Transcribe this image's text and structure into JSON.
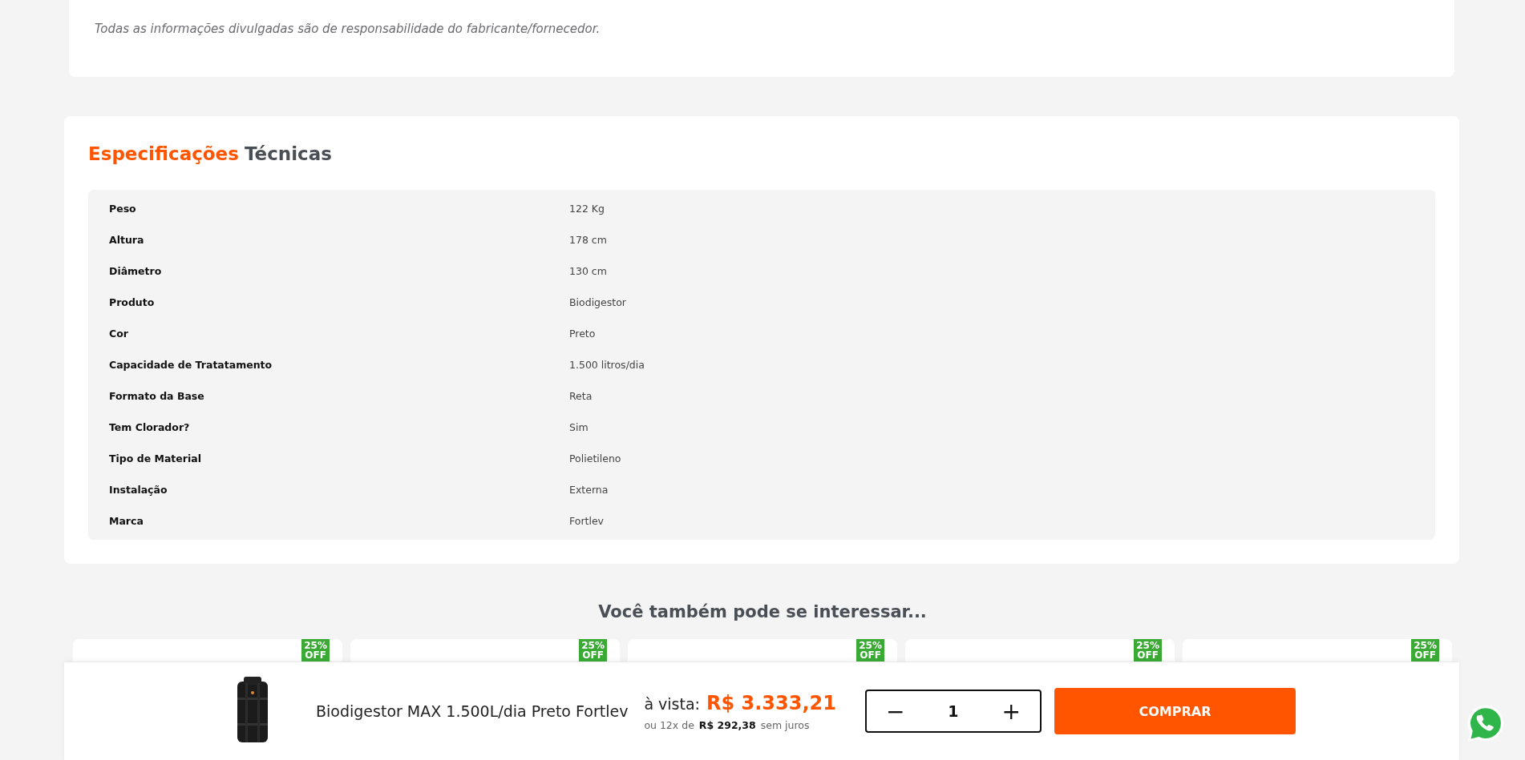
{
  "notes": [
    "Todas as informações divulgadas são de responsabilidade do fabricante/fornecedor."
  ],
  "specs": {
    "title_accent": "Especificações",
    "title_rest": "Técnicas",
    "rows": [
      {
        "label": "Peso",
        "value": "122 Kg"
      },
      {
        "label": "Altura",
        "value": "178 cm"
      },
      {
        "label": "Diâmetro",
        "value": "130 cm"
      },
      {
        "label": "Produto",
        "value": "Biodigestor"
      },
      {
        "label": "Cor",
        "value": "Preto"
      },
      {
        "label": "Capacidade de Tratatamento",
        "value": "1.500 litros/dia"
      },
      {
        "label": "Formato da Base",
        "value": "Reta"
      },
      {
        "label": "Tem Clorador?",
        "value": "Sim"
      },
      {
        "label": "Tipo de Material",
        "value": "Polietileno"
      },
      {
        "label": "Instalação",
        "value": "Externa"
      },
      {
        "label": "Marca",
        "value": "Fortlev"
      }
    ]
  },
  "related": {
    "title": "Você também pode se interessar...",
    "cards": [
      {
        "badge": [
          "25%",
          "OFF"
        ]
      },
      {
        "badge": [
          "25%",
          "OFF"
        ]
      },
      {
        "badge": [
          "25%",
          "OFF"
        ]
      },
      {
        "badge": [
          "25%",
          "OFF"
        ]
      },
      {
        "badge": [
          "25%",
          "OFF"
        ]
      }
    ]
  },
  "buy_bar": {
    "product_name": "Biodigestor MAX 1.500L/dia Preto Fortlev",
    "cash_label": "à vista:",
    "cash_price": "R$ 3.333,21",
    "installments_prefix": "ou 12x de",
    "installment_price": "R$ 292,38",
    "installments_suffix": "sem juros",
    "quantity": "1",
    "minus": "−",
    "plus": "+",
    "buy_label": "COMPRAR"
  }
}
